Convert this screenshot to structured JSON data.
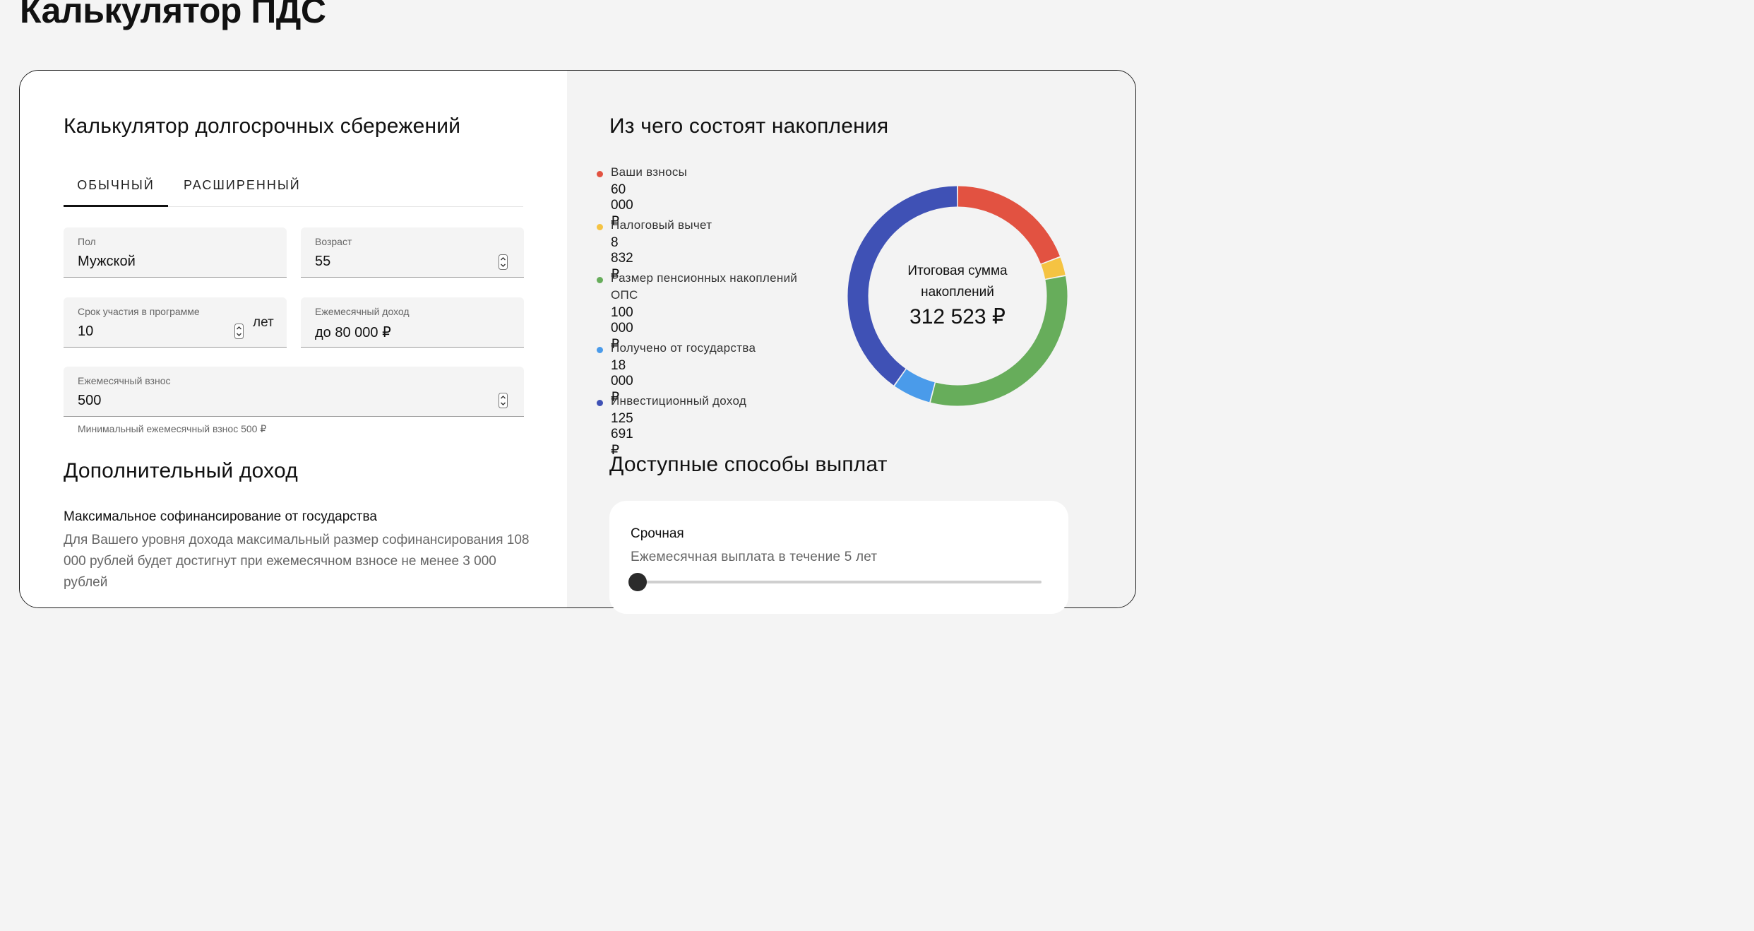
{
  "page": {
    "title": "Калькулятор ПДС"
  },
  "calculator": {
    "title": "Калькулятор долгосрочных сбережений",
    "tabs": [
      {
        "label": "ОБЫЧНЫЙ",
        "active": true
      },
      {
        "label": "РАСШИРЕННЫЙ",
        "active": false
      }
    ],
    "fields": {
      "gender": {
        "label": "Пол",
        "value": "Мужской"
      },
      "age": {
        "label": "Возраст",
        "value": "55"
      },
      "term": {
        "label": "Срок участия в программе",
        "value": "10",
        "suffix": "лет"
      },
      "income": {
        "label": "Ежемесячный доход",
        "value": "до 80 000 ₽"
      },
      "contribution": {
        "label": "Ежемесячный взнос",
        "value": "500",
        "hint": "Минимальный ежемесячный взнос 500 ₽"
      }
    }
  },
  "extra_income": {
    "title": "Дополнительный доход",
    "subtitle": "Максимальное софинансирование от государства",
    "text": "Для Вашего уровня дохода максимальный размер софинансирования 108 000 рублей будет достигнут при ежемесячном взносе не менее 3 000 рублей"
  },
  "composition": {
    "title": "Из чего состоят накопления",
    "items": [
      {
        "label": "Ваши взносы",
        "amount": "60 000 ₽",
        "value": 60000,
        "color": "#e25241"
      },
      {
        "label": "Налоговый вычет",
        "amount": "8 832 ₽",
        "value": 8832,
        "color": "#f5c342"
      },
      {
        "label": "Размер пенсионных накоплений ОПС",
        "amount": "100 000 ₽",
        "value": 100000,
        "color": "#67ad5b"
      },
      {
        "label": "Получено от государства",
        "amount": "18 000 ₽",
        "value": 18000,
        "color": "#4a9bea"
      },
      {
        "label": "Инвестиционный доход",
        "amount": "125 691 ₽",
        "value": 125691,
        "color": "#3f51b5"
      }
    ],
    "total_caption": "Итоговая сумма накоплений",
    "total": "312 523 ₽"
  },
  "payouts": {
    "title": "Доступные способы выплат",
    "option": {
      "title": "Срочная",
      "description": "Ежемесячная выплата в течение 5 лет",
      "slider_fraction": 0
    }
  }
}
